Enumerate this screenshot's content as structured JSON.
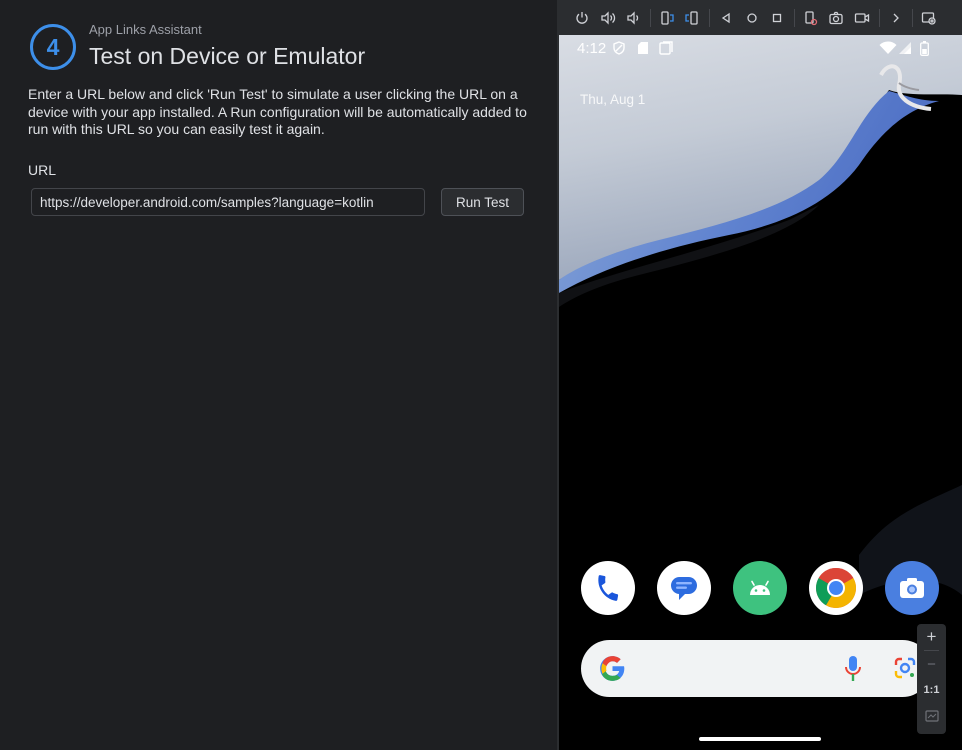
{
  "panel": {
    "step_number": "4",
    "breadcrumb": "App Links Assistant",
    "title": "Test on Device or Emulator",
    "description": "Enter a URL below and click 'Run Test' to simulate a user clicking the URL on a device with your app installed. A Run configuration will be automatically added to run with this URL so you can easily test it again.",
    "url_label": "URL",
    "url_value": "https://developer.android.com/samples?language=kotlin",
    "run_button_label": "Run Test"
  },
  "colors": {
    "accent": "#3d8fea",
    "ide_background": "#1e1f22",
    "toolbar_background": "#2b2d30"
  },
  "emulator": {
    "toolbar_icons": [
      "power-icon",
      "volume-up-icon",
      "volume-down-icon",
      "rotate-left-icon",
      "rotate-right-icon",
      "back-icon",
      "home-icon",
      "overview-icon",
      "fold-icon",
      "screenshot-icon",
      "screen-record-icon",
      "chevron-right-icon",
      "extended-controls-icon"
    ],
    "status_time": "4:12",
    "date": "Thu, Aug 1",
    "dock_apps": [
      "phone-app-icon",
      "messages-app-icon",
      "android-app-icon",
      "chrome-app-icon",
      "camera-app-icon"
    ],
    "zoom_controls": {
      "zoom_in": "+",
      "zoom_out": "−",
      "actual_size": "1:1"
    }
  }
}
